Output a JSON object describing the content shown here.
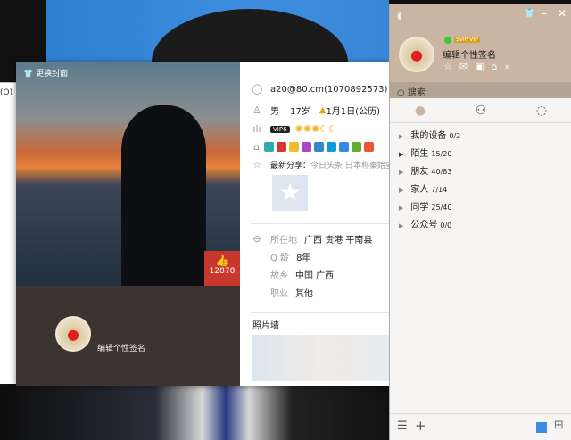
{
  "background": {
    "left_window_text": "(O)"
  },
  "card": {
    "change_cover": "更换封面",
    "likes": "12878",
    "signature": "编辑个性签名",
    "account": "a20@80.cm(1070892573)",
    "gender": "男",
    "age": "17岁",
    "birthday": "1月1日(公历)",
    "zodiac": "摩",
    "vip": "VIP6",
    "latest_share_label": "最新分享：",
    "latest_share_text": "今日头条 日本称秦始皇",
    "location_label": "所在地",
    "location": "广西 贵港 平南县",
    "qage_label": "Q 龄",
    "qage": "8年",
    "hometown_label": "故乡",
    "hometown": "中国 广西",
    "job_label": "职业",
    "job": "其他",
    "photo_wall": "照片墙"
  },
  "main": {
    "vip_badge": "SVIP VIP",
    "signature": "编辑个性签名",
    "search_placeholder": "搜索",
    "groups": [
      {
        "name": "我的设备",
        "count": "0/2"
      },
      {
        "name": "陌生",
        "count": "15/20"
      },
      {
        "name": "朋友",
        "count": "40/83"
      },
      {
        "name": "家人",
        "count": "7/14"
      },
      {
        "name": "同学",
        "count": "25/40"
      },
      {
        "name": "公众号",
        "count": "0/0"
      }
    ]
  }
}
